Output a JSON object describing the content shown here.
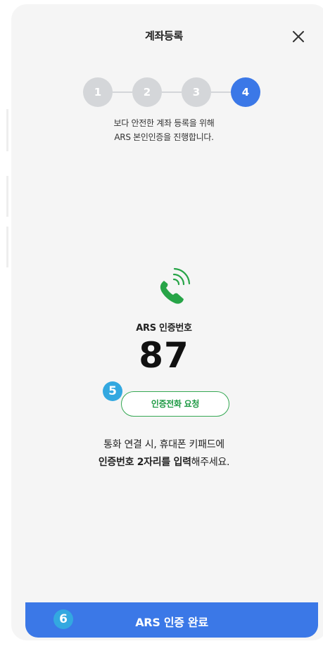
{
  "header": {
    "title": "계좌등록",
    "close_icon": "close-icon"
  },
  "steps": {
    "items": [
      "1",
      "2",
      "3",
      "4"
    ],
    "active": "4"
  },
  "guide": {
    "line1": "보다 안전한 계좌 등록을 위해",
    "line2": "ARS 본인인증을 진행합니다."
  },
  "ars": {
    "icon": "phone-ringing-icon",
    "label": "ARS 인증번호",
    "number": "87",
    "call_button": "인증전화 요청"
  },
  "instruction": {
    "line1": "통화 연결 시, 휴대폰 키패드에",
    "line2_strong": "인증번호 2자리를 입력",
    "line2_rest": "해주세요."
  },
  "footer": {
    "complete_button": "ARS 인증 완료"
  },
  "annotations": {
    "badge_call": "5",
    "badge_complete": "6"
  },
  "colors": {
    "primary": "#3b78e7",
    "inactive_step": "#d4d6d9",
    "phone_green": "#27a447",
    "call_button_border": "#35a853",
    "badge": "#33a8e0",
    "sheet_background": "#f5f5f5"
  }
}
